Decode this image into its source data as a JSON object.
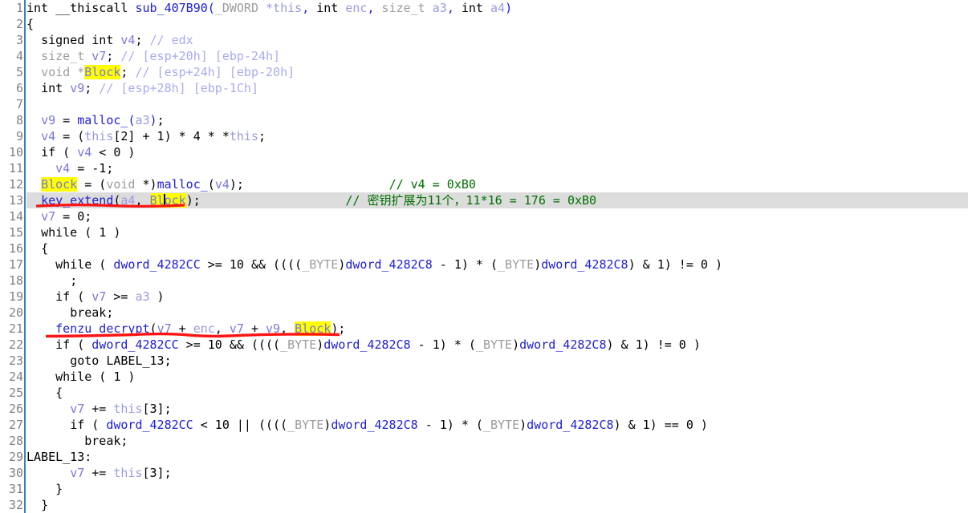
{
  "app": {
    "view": "ida-pseudocode",
    "current_line": 13,
    "highlighted_identifier": "Block",
    "highlight_color": "#ffff00",
    "current_line_bg": "#dcdcdc",
    "annotation_color": "#ff0000",
    "user_comment_color": "#007000",
    "auto_comment_color": "#aaaaf0",
    "gutter_separator_color": "#3f7fbf"
  },
  "line_numbers": [
    1,
    2,
    3,
    4,
    5,
    6,
    7,
    8,
    9,
    10,
    11,
    12,
    13,
    14,
    15,
    16,
    17,
    18,
    19,
    20,
    21,
    22,
    23,
    24,
    25,
    26,
    27,
    28,
    29,
    30,
    31,
    32
  ],
  "code": {
    "l1_ret": "int",
    "l1_conv": "__thiscall",
    "l1_name": "sub_407B90",
    "l1_args": "(_DWORD *this, int enc, size_t a3, int a4)",
    "l2": "{",
    "l3": "  signed int v4; // edx",
    "l4": "  size_t v7; // [esp+20h] [ebp-24h]",
    "l5": "  void *Block; // [esp+24h] [ebp-20h]",
    "l6": "  int v9; // [esp+28h] [ebp-1Ch]",
    "l7": "",
    "l8": "  v9 = malloc_(a3);",
    "l9": "  v4 = (this[2] + 1) * 4 * *this;",
    "l10": "  if ( v4 < 0 )",
    "l11": "    v4 = -1;",
    "l12": "  Block = (void *)malloc_(v4);",
    "l12_comment": "// v4 = 0xB0",
    "l13": "  key_extend(a4, Block);",
    "l13_comment": "// 密钥扩展为11个，11*16 = 176 = 0xB0",
    "l14": "  v7 = 0;",
    "l15": "  while ( 1 )",
    "l16": "  {",
    "l17": "    while ( dword_4282CC >= 10 && ((((_BYTE)dword_4282C8 - 1) * (_BYTE)dword_4282C8) & 1) != 0 )",
    "l18": "      ;",
    "l19": "    if ( v7 >= a3 )",
    "l20": "      break;",
    "l21": "    fenzu_decrypt(v7 + enc, v7 + v9, Block);",
    "l22": "    if ( dword_4282CC >= 10 && ((((_BYTE)dword_4282C8 - 1) * (_BYTE)dword_4282C8) & 1) != 0 )",
    "l23": "      goto LABEL_13;",
    "l24": "    while ( 1 )",
    "l25": "    {",
    "l26": "      v7 += this[3];",
    "l27": "      if ( dword_4282CC < 10 || ((((_BYTE)dword_4282C8 - 1) * (_BYTE)dword_4282C8) & 1) == 0 )",
    "l28": "        break;",
    "l29": "LABEL_13:",
    "l30": "      v7 += this[3];",
    "l31": "    }",
    "l32": "  }"
  },
  "tokens": {
    "int": "int",
    "thiscall": "__thiscall",
    "sub_407B90": "sub_407B90",
    "dword_open": "(",
    "_DWORD": "_DWORD",
    "star_this": "*this",
    "comma": ", ",
    "enc": "enc",
    "size_t": "size_t",
    "a3": "a3",
    "a4": "a4",
    "close": ")",
    "brace_open": "{",
    "brace_close": "}",
    "signed": "signed",
    "v4": "v4",
    "v7": "v7",
    "v9": "v9",
    "void": "void",
    "Block": "Block",
    "Bl": "Bl",
    "ock": "ock",
    "malloc_": "malloc_",
    "key_extend": "key_extend",
    "fenzu_decrypt": "fenzu_decrypt",
    "dword_4282CC": "dword_4282CC",
    "dword_4282C8": "dword_4282C8",
    "_BYTE": "_BYTE",
    "LABEL_13": "LABEL_13",
    "LABEL_13_colon": "LABEL_13:",
    "while": "while",
    "if": "if",
    "break": "break;",
    "goto": "goto",
    "semi": ";",
    "cmt_edx": "// edx",
    "cmt_v7": "// [esp+20h] [ebp-24h]",
    "cmt_Block": "// [esp+24h] [ebp-20h]",
    "cmt_v9": "// [esp+28h] [ebp-1Ch]",
    "cmt_v4_b0": "// v4 = 0xB0",
    "cmt_key": "// 密钥扩展为11个，11*16 = 176 = 0xB0"
  },
  "annotations": [
    {
      "name": "underline-key-extend",
      "target_line": 13,
      "color": "#ff0000"
    },
    {
      "name": "underline-fenzu-decrypt",
      "target_line": 21,
      "color": "#ff0000"
    }
  ]
}
